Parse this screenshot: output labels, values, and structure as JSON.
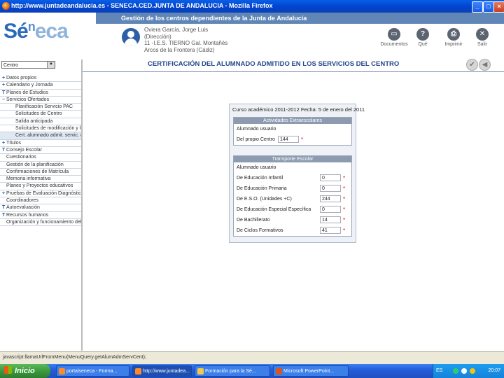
{
  "window": {
    "title": "http://www.juntadeandalucia.es - SENECA.CED.JUNTA DE ANDALUCIA - Mozilla Firefox",
    "min_label": "_",
    "max_label": "□",
    "close_label": "×"
  },
  "header": {
    "band_title": "Gestión de los centros dependientes de la Junta de Andalucía",
    "logo_part1": "Sé",
    "logo_part2": "n",
    "logo_part3": "eca",
    "user_line1": "Oviera García, Jorge Luis",
    "user_line2": "(Dirección)",
    "user_line3": "11 -I.E.S. TIERNO Gal. Montañés",
    "user_line4": "Arcos de la Frontera (Cádiz)",
    "tools": [
      {
        "label": "Documentos",
        "glyph": "▭"
      },
      {
        "label": "Qué",
        "glyph": "?"
      },
      {
        "label": "Imprimir",
        "glyph": "⎙"
      },
      {
        "label": "Salir",
        "glyph": "✕"
      }
    ]
  },
  "sidebar": {
    "context": "Centro",
    "context_arrow": "▼",
    "items": [
      {
        "pm": "+",
        "label": "Datos propios"
      },
      {
        "pm": "+",
        "label": "Calendario y Jornada"
      },
      {
        "pm": "T",
        "label": "Planes de Estudios"
      },
      {
        "pm": "−",
        "label": "Servicios Ofertados"
      },
      {
        "pm": "",
        "label": "Planificación Servicio PAC"
      },
      {
        "pm": "",
        "label": "Solicitudes de Centro"
      },
      {
        "pm": "",
        "label": "Salida anticipada"
      },
      {
        "pm": "",
        "label": "Solicitudes de modificación y line"
      },
      {
        "pm": "",
        "label": "Cert. alumnado admit. servic. cent"
      },
      {
        "pm": "+",
        "label": "Títulos"
      },
      {
        "pm": "T",
        "label": "Consejo Escolar"
      },
      {
        "pm": "",
        "label": "Cuestionarios"
      },
      {
        "pm": "",
        "label": "Gestión de la planificación"
      },
      {
        "pm": "",
        "label": "Confirmaciones de Matrícula"
      },
      {
        "pm": "",
        "label": "Memoria informativa"
      },
      {
        "pm": "",
        "label": "Planes y Proyectos educativos"
      },
      {
        "pm": "+",
        "label": "Pruebas de Evaluación Diagnóstica"
      },
      {
        "pm": "",
        "label": "Coordinadores"
      },
      {
        "pm": "T",
        "label": "Autoevaluación"
      },
      {
        "pm": "T",
        "label": "Recursos humanos"
      },
      {
        "pm": "",
        "label": "Organización y funcionamiento del E"
      }
    ]
  },
  "main": {
    "title": "CERTIFICACIÓN DEL ALUMNADO ADMITIDO EN LOS SERVICIOS DEL CENTRO",
    "confirm_glyph": "✔",
    "back_glyph": "◀",
    "curso": "Curso académico 2011-2012 Fecha: 5 de enero del 2011",
    "extraescolares": {
      "header": "Actividades Extraescolares",
      "sub": "Alumnado usuario",
      "rows": [
        {
          "label": "Del propio Centro",
          "value": "144"
        }
      ]
    },
    "transporte": {
      "header": "Transporte Escolar",
      "sub": "Alumnado usuario",
      "rows": [
        {
          "label": "De Educación Infantil",
          "value": "0"
        },
        {
          "label": "De Educación Primaria",
          "value": "0"
        },
        {
          "label": "De E.S.O. (Unidades +C)",
          "value": "244"
        },
        {
          "label": "De Educación Especial Específica",
          "value": "0"
        },
        {
          "label": "De Bachillerato",
          "value": "14"
        },
        {
          "label": "De Ciclos Formativos",
          "value": "41"
        }
      ]
    },
    "required_mark": "*"
  },
  "status": {
    "text": "javascript:llamaUrlFromMenu(MenuQuery.getAlumAdmServCent);"
  },
  "taskbar": {
    "start": "Inicio",
    "tasks": [
      {
        "label": "portalseneca - Forma...",
        "color": "#ff8a2a"
      },
      {
        "label": "http://www.juntadea...",
        "color": "#ff8a2a"
      },
      {
        "label": "Formación para la Sé...",
        "color": "#f2c94c"
      },
      {
        "label": "Microsoft PowerPoint...",
        "color": "#d9541e"
      }
    ],
    "lang": "ES",
    "clock": "20:07"
  }
}
